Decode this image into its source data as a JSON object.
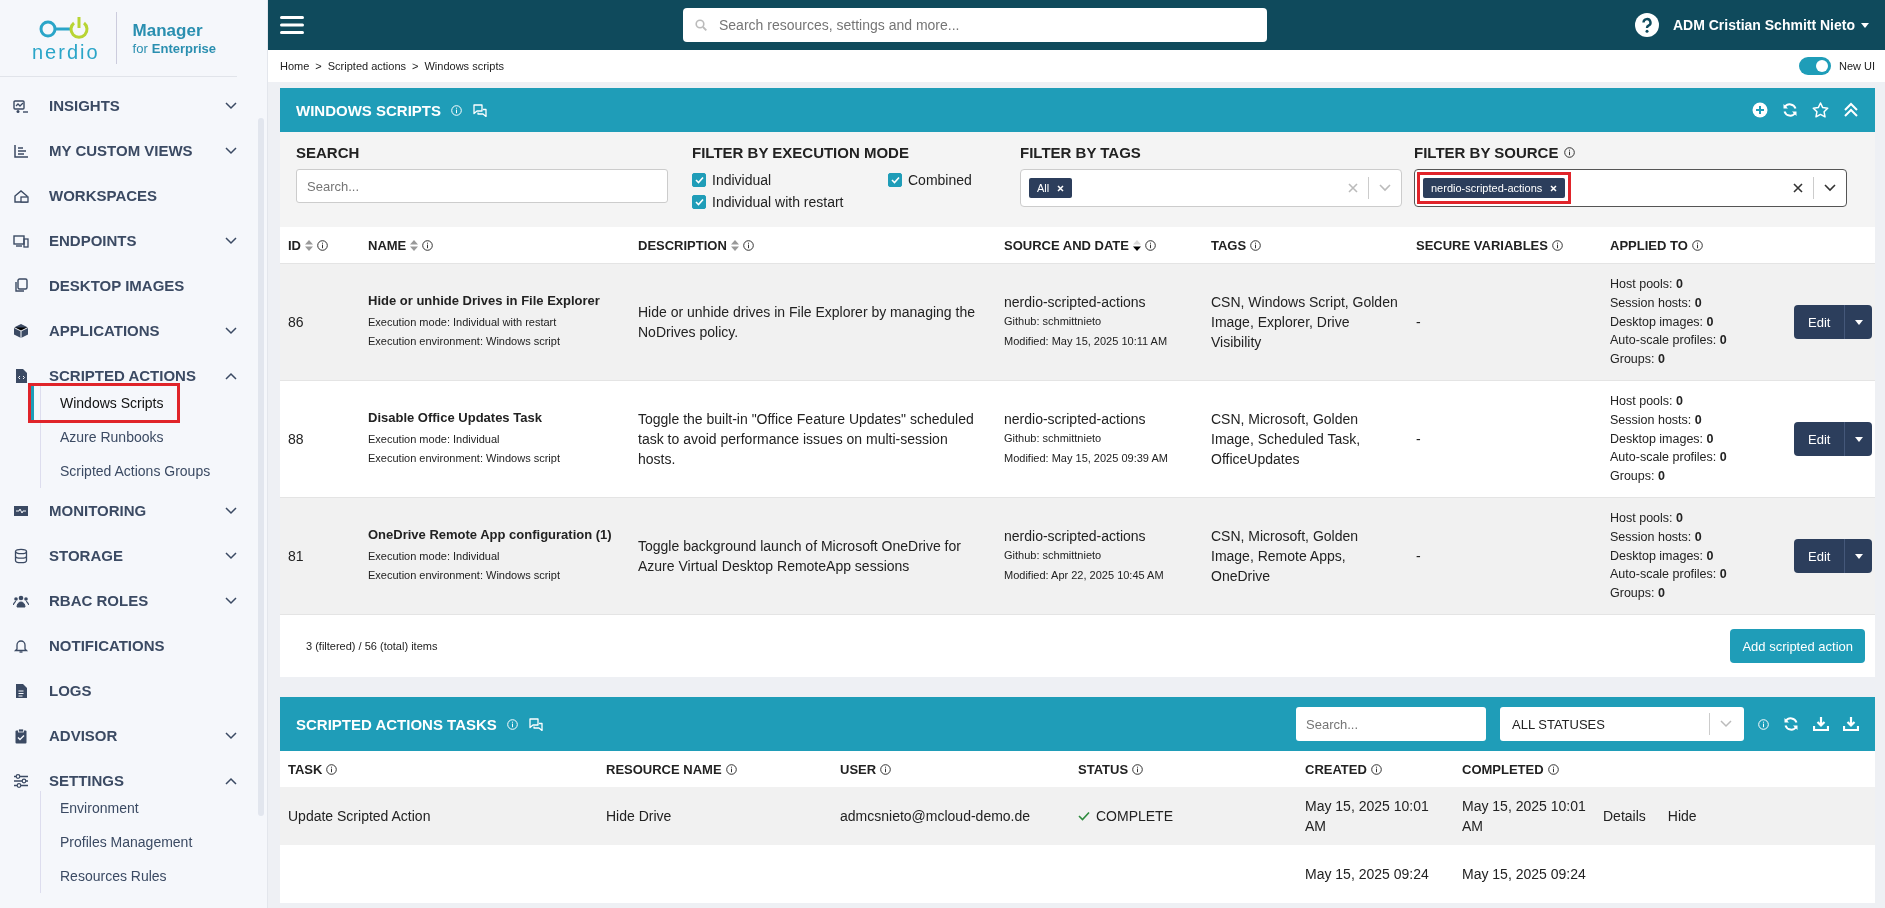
{
  "sidebar": {
    "logo": {
      "wordmark": "nerdio",
      "product": "Manager",
      "edition_prefix": "for",
      "edition": "Enterprise"
    },
    "items": [
      {
        "label": "INSIGHTS",
        "kind": "group",
        "expanded": false
      },
      {
        "label": "MY CUSTOM VIEWS",
        "kind": "group",
        "expanded": false
      },
      {
        "label": "WORKSPACES",
        "kind": "link"
      },
      {
        "label": "ENDPOINTS",
        "kind": "group",
        "expanded": false
      },
      {
        "label": "DESKTOP IMAGES",
        "kind": "link"
      },
      {
        "label": "APPLICATIONS",
        "kind": "group",
        "expanded": false
      },
      {
        "label": "SCRIPTED ACTIONS",
        "kind": "group",
        "expanded": true,
        "children": [
          {
            "label": "Windows Scripts",
            "selected": true,
            "highlighted": true
          },
          {
            "label": "Azure Runbooks",
            "selected": false,
            "highlighted": false
          },
          {
            "label": "Scripted Actions Groups",
            "selected": false,
            "highlighted": false
          }
        ]
      },
      {
        "label": "MONITORING",
        "kind": "group",
        "expanded": false
      },
      {
        "label": "STORAGE",
        "kind": "group",
        "expanded": false
      },
      {
        "label": "RBAC ROLES",
        "kind": "group",
        "expanded": false
      },
      {
        "label": "NOTIFICATIONS",
        "kind": "link"
      },
      {
        "label": "LOGS",
        "kind": "link"
      },
      {
        "label": "ADVISOR",
        "kind": "group",
        "expanded": false
      },
      {
        "label": "SETTINGS",
        "kind": "group",
        "expanded": true,
        "children": [
          {
            "label": "Environment",
            "selected": false,
            "highlighted": false
          },
          {
            "label": "Profiles Management",
            "selected": false,
            "highlighted": false
          },
          {
            "label": "Resources Rules",
            "selected": false,
            "highlighted": false
          }
        ]
      }
    ]
  },
  "topbar": {
    "search": {
      "placeholder": "Search resources, settings and more..."
    },
    "user": "ADM Cristian Schmitt Nieto"
  },
  "breadcrumb": {
    "items": [
      "Home",
      "Scripted actions",
      "Windows scripts"
    ],
    "separator": ">"
  },
  "new_ui": {
    "label": "New UI",
    "on": true
  },
  "scripts_panel": {
    "title": "WINDOWS SCRIPTS",
    "filters": {
      "search": {
        "label": "SEARCH",
        "placeholder": "Search..."
      },
      "execution_mode": {
        "label": "FILTER BY EXECUTION MODE",
        "options": [
          {
            "label": "Individual",
            "checked": true
          },
          {
            "label": "Individual with restart",
            "checked": true
          },
          {
            "label": "Combined",
            "checked": true
          }
        ]
      },
      "tags": {
        "label": "FILTER BY TAGS",
        "chips": [
          {
            "label": "All",
            "highlighted": false
          }
        ]
      },
      "source": {
        "label": "FILTER BY SOURCE",
        "chips": [
          {
            "label": "nerdio-scripted-actions",
            "highlighted": true
          }
        ]
      }
    },
    "columns": [
      {
        "label": "ID",
        "sortable": true,
        "sorted_descending": false
      },
      {
        "label": "NAME",
        "sortable": true,
        "sorted_descending": false
      },
      {
        "label": "DESCRIPTION",
        "sortable": true,
        "sorted_descending": false
      },
      {
        "label": "SOURCE AND DATE",
        "sortable": true,
        "sorted_descending": true
      },
      {
        "label": "TAGS",
        "sortable": false
      },
      {
        "label": "SECURE VARIABLES",
        "sortable": false
      },
      {
        "label": "APPLIED TO",
        "sortable": false
      }
    ],
    "rows": [
      {
        "id": "86",
        "name": "Hide or unhide Drives in File Explorer",
        "mode": "Execution mode: Individual with restart",
        "environment": "Execution environment: Windows script",
        "description": "Hide or unhide drives in File Explorer by managing the NoDrives policy.",
        "source": "nerdio-scripted-actions",
        "github": "Github: schmittnieto",
        "modified": "Modified: May 15, 2025 10:11 AM",
        "tags": "CSN, Windows Script, Golden Image, Explorer, Drive Visibility",
        "secure": "-",
        "applied": [
          {
            "label": "Host pools:",
            "value": "0"
          },
          {
            "label": "Session hosts:",
            "value": "0"
          },
          {
            "label": "Desktop images:",
            "value": "0"
          },
          {
            "label": "Auto-scale profiles:",
            "value": "0"
          },
          {
            "label": "Groups:",
            "value": "0"
          }
        ],
        "action": "Edit"
      },
      {
        "id": "88",
        "name": "Disable Office Updates Task",
        "mode": "Execution mode: Individual",
        "environment": "Execution environment: Windows script",
        "description": "Toggle the built-in \"Office Feature Updates\" scheduled task to avoid performance issues on multi-session hosts.",
        "source": "nerdio-scripted-actions",
        "github": "Github: schmittnieto",
        "modified": "Modified: May 15, 2025 09:39 AM",
        "tags": "CSN, Microsoft, Golden Image, Scheduled Task, OfficeUpdates",
        "secure": "-",
        "applied": [
          {
            "label": "Host pools:",
            "value": "0"
          },
          {
            "label": "Session hosts:",
            "value": "0"
          },
          {
            "label": "Desktop images:",
            "value": "0"
          },
          {
            "label": "Auto-scale profiles:",
            "value": "0"
          },
          {
            "label": "Groups:",
            "value": "0"
          }
        ],
        "action": "Edit"
      },
      {
        "id": "81",
        "name": "OneDrive Remote App configuration (1)",
        "mode": "Execution mode: Individual",
        "environment": "Execution environment: Windows script",
        "description": "Toggle background launch of Microsoft OneDrive for Azure Virtual Desktop RemoteApp sessions",
        "source": "nerdio-scripted-actions",
        "github": "Github: schmittnieto",
        "modified": "Modified: Apr 22, 2025 10:45 AM",
        "tags": "CSN, Microsoft, Golden Image, Remote Apps, OneDrive",
        "secure": "-",
        "applied": [
          {
            "label": "Host pools:",
            "value": "0"
          },
          {
            "label": "Session hosts:",
            "value": "0"
          },
          {
            "label": "Desktop images:",
            "value": "0"
          },
          {
            "label": "Auto-scale profiles:",
            "value": "0"
          },
          {
            "label": "Groups:",
            "value": "0"
          }
        ],
        "action": "Edit"
      }
    ],
    "count": "3 (filtered) / 56 (total) items",
    "add_button": "Add scripted action"
  },
  "tasks_panel": {
    "title": "SCRIPTED ACTIONS TASKS",
    "search": {
      "placeholder": "Search..."
    },
    "status_filter": "ALL STATUSES",
    "columns": [
      "TASK",
      "RESOURCE NAME",
      "USER",
      "STATUS",
      "CREATED",
      "COMPLETED"
    ],
    "rows": [
      {
        "task": "Update Scripted Action",
        "resource": "Hide Drive",
        "user": "admcsnieto@mcloud-demo.de",
        "status": "COMPLETE",
        "completed_ok": true,
        "created": "May 15, 2025 10:01 AM",
        "completed": "May 15, 2025 10:01 AM",
        "actions": [
          "Details",
          "Hide"
        ]
      },
      {
        "created": "May 15, 2025 09:24",
        "completed": "May 15, 2025 09:24"
      }
    ]
  }
}
